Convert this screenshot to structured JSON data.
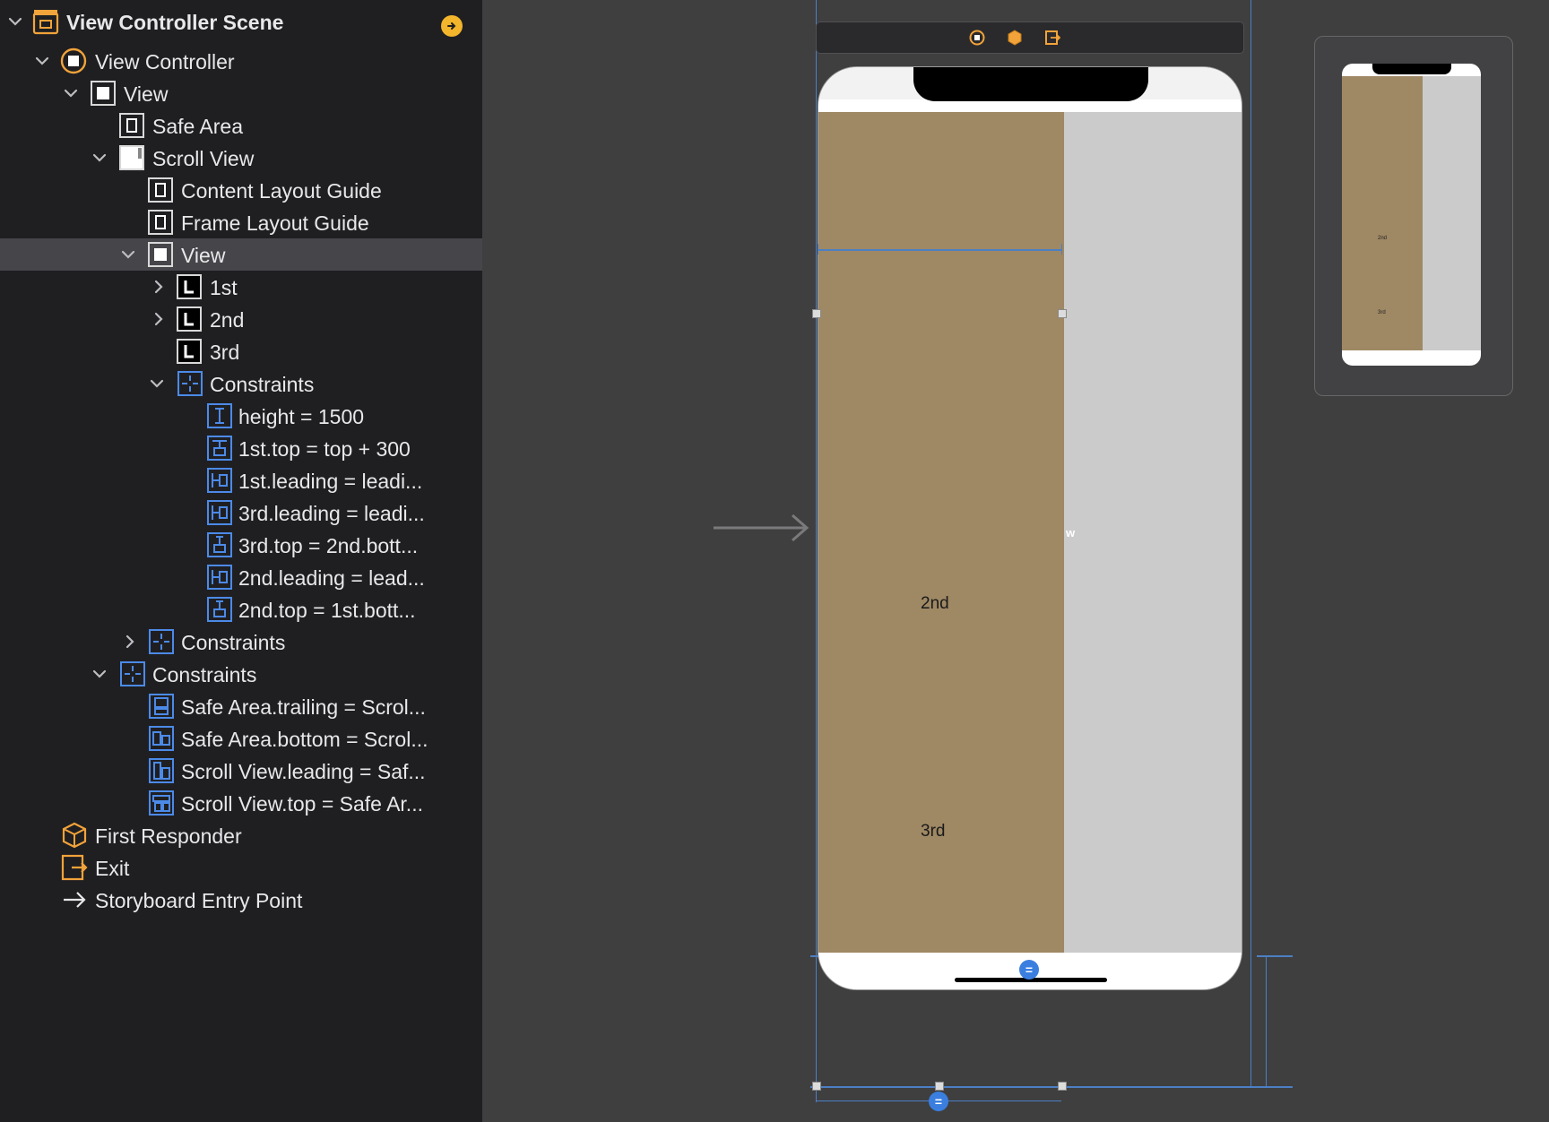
{
  "outline": {
    "rows": [
      {
        "label": "View Controller Scene",
        "icon": "scene-icon",
        "disclosure": "expanded"
      },
      {
        "label": "View Controller",
        "icon": "view-controller-icon",
        "disclosure": "expanded"
      },
      {
        "label": "View",
        "icon": "view-icon",
        "disclosure": "expanded"
      },
      {
        "label": "Safe Area",
        "icon": "layout-guide-icon",
        "disclosure": "none"
      },
      {
        "label": "Scroll View",
        "icon": "scroll-view-icon",
        "disclosure": "expanded"
      },
      {
        "label": "Content Layout Guide",
        "icon": "layout-guide-icon",
        "disclosure": "none"
      },
      {
        "label": "Frame Layout Guide",
        "icon": "layout-guide-icon",
        "disclosure": "none"
      },
      {
        "label": "View",
        "icon": "view-icon",
        "disclosure": "expanded",
        "selected": true
      },
      {
        "label": "1st",
        "icon": "label-icon",
        "disclosure": "collapsed"
      },
      {
        "label": "2nd",
        "icon": "label-icon",
        "disclosure": "collapsed"
      },
      {
        "label": "3rd",
        "icon": "label-icon",
        "disclosure": "none"
      },
      {
        "label": "Constraints",
        "icon": "constraints-icon",
        "disclosure": "expanded"
      },
      {
        "label": "height = 1500",
        "icon": "height-constraint-icon",
        "disclosure": "none"
      },
      {
        "label": "1st.top = top + 300",
        "icon": "top-constraint-icon",
        "disclosure": "none"
      },
      {
        "label": "1st.leading = leadi...",
        "icon": "leading-constraint-icon",
        "disclosure": "none"
      },
      {
        "label": "3rd.leading = leadi...",
        "icon": "leading-constraint-icon",
        "disclosure": "none"
      },
      {
        "label": "3rd.top = 2nd.bott...",
        "icon": "vertical-spacing-icon",
        "disclosure": "none"
      },
      {
        "label": "2nd.leading = lead...",
        "icon": "leading-constraint-icon",
        "disclosure": "none"
      },
      {
        "label": "2nd.top = 1st.bott...",
        "icon": "vertical-spacing-icon",
        "disclosure": "none"
      },
      {
        "label": "Constraints",
        "icon": "constraints-icon",
        "disclosure": "collapsed"
      },
      {
        "label": "Constraints",
        "icon": "constraints-icon",
        "disclosure": "expanded"
      },
      {
        "label": "Safe Area.trailing = Scrol...",
        "icon": "trailing-constraint-icon",
        "disclosure": "none"
      },
      {
        "label": "Safe Area.bottom = Scrol...",
        "icon": "bottom-constraint-icon",
        "disclosure": "none"
      },
      {
        "label": "Scroll View.leading = Saf...",
        "icon": "leading-constraint-icon",
        "disclosure": "none"
      },
      {
        "label": "Scroll View.top = Safe Ar...",
        "icon": "top-constraint-icon",
        "disclosure": "none"
      },
      {
        "label": "First Responder",
        "icon": "first-responder-icon",
        "disclosure": "none"
      },
      {
        "label": "Exit",
        "icon": "exit-icon",
        "disclosure": "none"
      },
      {
        "label": "Storyboard Entry Point",
        "icon": "arrow-right-icon",
        "disclosure": "none"
      }
    ]
  },
  "canvas": {
    "labels": {
      "second": "2nd",
      "third": "3rd",
      "w_marker": "w"
    },
    "minimap": {
      "second": "2nd",
      "third": "3rd"
    },
    "colors": {
      "brown": "#9f8864",
      "gray": "#cbcbcb",
      "accent": "#4c7fc4",
      "scene_icon": "#f2a33a"
    }
  }
}
